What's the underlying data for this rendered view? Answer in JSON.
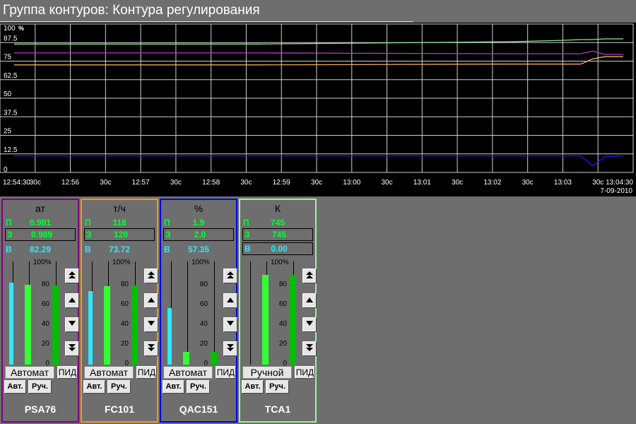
{
  "window": {
    "title": "Группа контуров: Контура регулирования"
  },
  "chart_data": {
    "type": "line",
    "y_unit": "%",
    "ylim": [
      0,
      100
    ],
    "y_ticks": [
      "100",
      "87.5",
      "75",
      "62.5",
      "50",
      "37.5",
      "25",
      "12.5",
      "0"
    ],
    "x_tick_labels": [
      "12:54:30",
      "30с",
      "12:56",
      "30с",
      "12:57",
      "30с",
      "12:58",
      "30с",
      "12:59",
      "30с",
      "13:00",
      "30с",
      "13:01",
      "30с",
      "13:02",
      "30с",
      "13:03",
      "30с",
      "13:04:30"
    ],
    "x_end_date": "7-09-2010",
    "grid": true,
    "x_minutes": [
      0,
      4,
      8,
      8.1,
      9,
      9.3,
      9.5,
      9.7,
      10
    ],
    "series": [
      {
        "color": "#90e890",
        "values": [
          86.5,
          86.5,
          88,
          88,
          89,
          89.5,
          89.5,
          90,
          90
        ]
      },
      {
        "color": "#b040c0",
        "values": [
          80.5,
          80.5,
          80,
          80,
          80,
          80,
          81.7,
          79.5,
          79.5
        ]
      },
      {
        "color": "#e8b060",
        "values": [
          72.5,
          72.5,
          73,
          73,
          73,
          73,
          76.5,
          78,
          78
        ]
      },
      {
        "color": "#1a1aff",
        "values": [
          11.2,
          11.2,
          11.2,
          11.2,
          11.2,
          11.2,
          4.5,
          10.5,
          11.2
        ]
      }
    ]
  },
  "panels": [
    {
      "tag": "PSA76",
      "unit": "ат",
      "border": "#800080",
      "p_letter": "П",
      "p_value": "0.981",
      "z_letter": "З",
      "z_value": "0.989",
      "v_letter": "В",
      "v_value": "82.29",
      "bars": {
        "v": 0.83,
        "p": 0.81,
        "out": 0.8
      },
      "mode": "Автомат",
      "pid": "ПИД",
      "auto": "Авт.",
      "manual": "Руч."
    },
    {
      "tag": "FC101",
      "unit": "т/ч",
      "border": "#ff9800",
      "p_letter": "П",
      "p_value": "118",
      "z_letter": "З",
      "z_value": "120",
      "v_letter": "В",
      "v_value": "73.72",
      "bars": {
        "v": 0.74,
        "p": 0.79,
        "out": 0.8
      },
      "mode": "Автомат",
      "pid": "ПИД",
      "auto": "Авт.",
      "manual": "Руч."
    },
    {
      "tag": "QAC151",
      "unit": "%",
      "border": "#0000ee",
      "p_letter": "П",
      "p_value": "1.9",
      "z_letter": "З",
      "z_value": "2.0",
      "v_letter": "В",
      "v_value": "57.35",
      "bars": {
        "v": 0.57,
        "p": 0.13,
        "out": 0.13
      },
      "mode": "Автомат",
      "pid": "ПИД",
      "auto": "Авт.",
      "manual": "Руч."
    },
    {
      "tag": "TCA1",
      "unit": "К",
      "border": "#a0f0a0",
      "p_letter": "П",
      "p_value": "745",
      "z_letter": "З",
      "z_value": "745",
      "v_letter": "В",
      "v_value": "0.00",
      "bars": {
        "v": 0,
        "p": 0.91,
        "out": 0.91
      },
      "mode": "Ручной",
      "pid": "ПИД",
      "auto": "Авт.",
      "manual": "Руч."
    }
  ],
  "scale": {
    "top": "100%",
    "labels": [
      "80",
      "60",
      "40",
      "20",
      "0"
    ]
  },
  "icons": {
    "up_fast": "double-up-arrow-icon",
    "up": "up-arrow-icon",
    "down": "down-arrow-icon",
    "down_fast": "double-down-arrow-icon"
  }
}
